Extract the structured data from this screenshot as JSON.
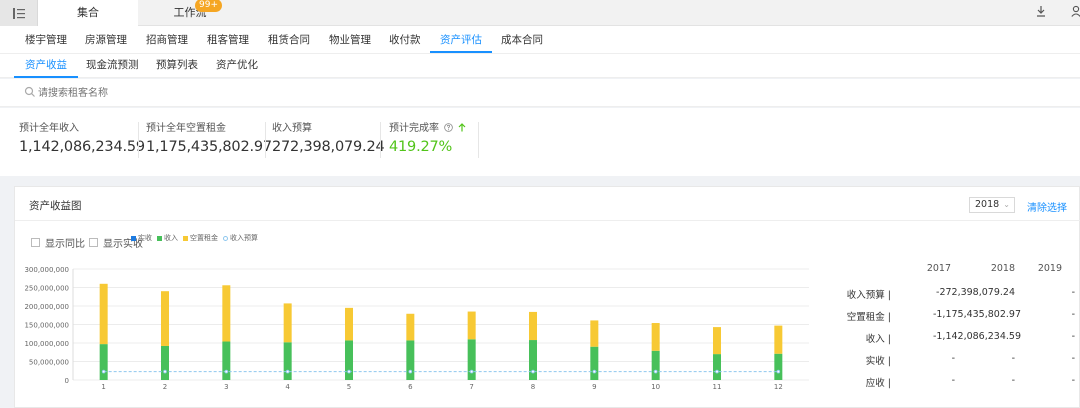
{
  "topbar": {
    "menu_icon": "list-icon",
    "tab_active": "集合",
    "tab_work": "工作流",
    "badge": "99+",
    "download_icon": "download-icon",
    "user_icon": "user-icon"
  },
  "nav1": [
    "楼宇管理",
    "房源管理",
    "招商管理",
    "租客管理",
    "租赁合同",
    "物业管理",
    "收付款",
    "资产评估",
    "成本合同"
  ],
  "nav1_active": "资产评估",
  "nav2": [
    "资产收益",
    "现金流预测",
    "预算列表",
    "资产优化"
  ],
  "nav2_active": "资产收益",
  "search": {
    "placeholder": "请搜索租客名称",
    "icon": "search-icon"
  },
  "stats": [
    {
      "label": "预计全年收入",
      "value": "1,142,086,234.59"
    },
    {
      "label": "预计全年空置租金",
      "value": "1,175,435,802.97"
    },
    {
      "label": "收入预算",
      "value": "272,398,079.24"
    },
    {
      "label": "预计完成率",
      "value": "419.27%",
      "help_icon": "question-circle-icon",
      "trend_icon": "arrow-up-icon"
    }
  ],
  "panel": {
    "title": "资产收益图",
    "year": "2018",
    "year_arrow": "⌄",
    "clear": "清除选择",
    "show_yoy": "显示同比",
    "show_actual": "显示实收"
  },
  "chart_data": {
    "type": "bar",
    "stacked": true,
    "categories": [
      "1",
      "2",
      "3",
      "4",
      "5",
      "6",
      "7",
      "8",
      "9",
      "10",
      "11",
      "12"
    ],
    "ylim": [
      0,
      300000000
    ],
    "yticks": [
      "300,000,000",
      "250,000,000",
      "200,000,000",
      "150,000,000",
      "100,000,000",
      "50,000,000",
      "0"
    ],
    "legend": [
      "实收",
      "收入",
      "空置租金",
      "收入预算"
    ],
    "series": [
      {
        "name": "实收",
        "color": "#1e7be0",
        "values": [
          0,
          0,
          0,
          0,
          0,
          0,
          0,
          0,
          0,
          0,
          0,
          0
        ]
      },
      {
        "name": "收入",
        "color": "#47c05a",
        "values": [
          97000000,
          92000000,
          104000000,
          102000000,
          107000000,
          107000000,
          110000000,
          108000000,
          90000000,
          79000000,
          70000000,
          71000000
        ]
      },
      {
        "name": "空置租金",
        "color": "#f7c934",
        "values": [
          163000000,
          148000000,
          152000000,
          105000000,
          88000000,
          72000000,
          75000000,
          76000000,
          71000000,
          75000000,
          73000000,
          76000000
        ]
      },
      {
        "name": "收入预算",
        "color": "#8ec7ee",
        "style": "dashed-line",
        "values": [
          22700000,
          22700000,
          22700000,
          22700000,
          22700000,
          22700000,
          22700000,
          22700000,
          22700000,
          22700000,
          22700000,
          22700000
        ]
      }
    ]
  },
  "summary_table": {
    "years": [
      "2017",
      "2018",
      "2019"
    ],
    "rows": [
      {
        "label": "收入预算 |",
        "values": [
          "",
          "-272,398,079.24",
          "-"
        ]
      },
      {
        "label": "空置租金 |",
        "values": [
          "",
          "-1,175,435,802.97",
          "-"
        ]
      },
      {
        "label": "收入 |",
        "values": [
          "",
          "-1,142,086,234.59",
          "-"
        ]
      },
      {
        "label": "实收 |",
        "values": [
          "-",
          "-",
          "-"
        ]
      },
      {
        "label": "应收 |",
        "values": [
          "-",
          "-",
          "-"
        ]
      }
    ]
  }
}
